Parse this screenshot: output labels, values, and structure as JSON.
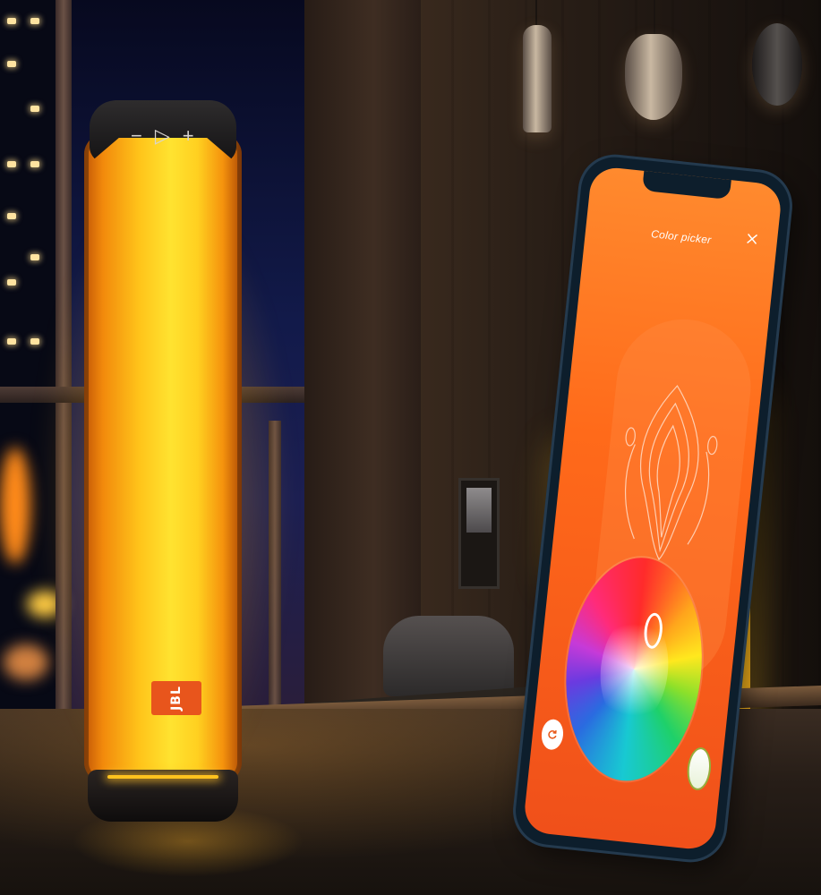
{
  "speaker": {
    "brand_logo": "JBL",
    "top_buttons": [
      "−",
      "▷",
      "+"
    ]
  },
  "phone": {
    "screen_title": "Color picker",
    "close_icon": "close-icon",
    "reset_icon": "refresh-icon"
  },
  "colors": {
    "screen_orange": "#ff6a1a",
    "speaker_yellow": "#ffd020",
    "logo_orange": "#e8551c"
  }
}
